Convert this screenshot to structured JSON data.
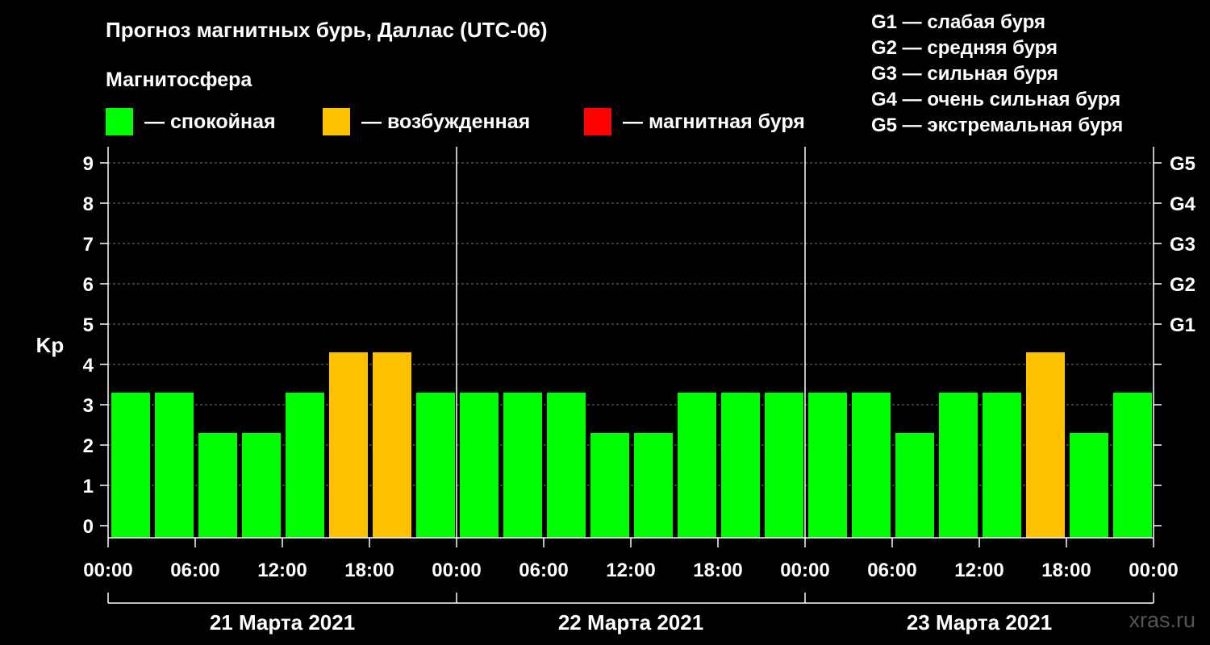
{
  "title": "Прогноз магнитных бурь, Даллас (UTC-06)",
  "subtitle": "Магнитосфера",
  "legend": [
    {
      "label": "— спокойная",
      "color": "#00ff00"
    },
    {
      "label": "— возбужденная",
      "color": "#ffc000"
    },
    {
      "label": "— магнитная буря",
      "color": "#ff0000"
    }
  ],
  "g_legend": [
    "G1 — слабая буря",
    "G2 — средняя буря",
    "G3 — сильная буря",
    "G4 — очень сильная буря",
    "G5 — экстремальная буря"
  ],
  "watermark": "xras.ru",
  "chart_data": {
    "type": "bar",
    "ylabel": "Kp",
    "ylim": [
      0,
      9
    ],
    "y_ticks": [
      "0",
      "1",
      "2",
      "3",
      "4",
      "5",
      "6",
      "7",
      "8",
      "9"
    ],
    "right_ticks": [
      {
        "kp": 5,
        "label": "G1"
      },
      {
        "kp": 6,
        "label": "G2"
      },
      {
        "kp": 7,
        "label": "G3"
      },
      {
        "kp": 8,
        "label": "G4"
      },
      {
        "kp": 9,
        "label": "G5"
      }
    ],
    "grid": true,
    "x_tick_labels": [
      "00:00",
      "06:00",
      "12:00",
      "18:00",
      "00:00",
      "06:00",
      "12:00",
      "18:00",
      "00:00",
      "06:00",
      "12:00",
      "18:00",
      "00:00"
    ],
    "days": [
      "21 Марта 2021",
      "22 Марта 2021",
      "23 Марта 2021"
    ],
    "interval_hours": 3,
    "values": [
      3,
      3,
      2,
      2,
      3,
      4,
      4,
      3,
      3,
      3,
      3,
      2,
      2,
      3,
      3,
      3,
      3,
      3,
      2,
      3,
      3,
      4,
      2,
      3
    ],
    "colors": {
      "quiet": "#00ff00",
      "active": "#ffc000",
      "storm": "#ff0000"
    }
  }
}
